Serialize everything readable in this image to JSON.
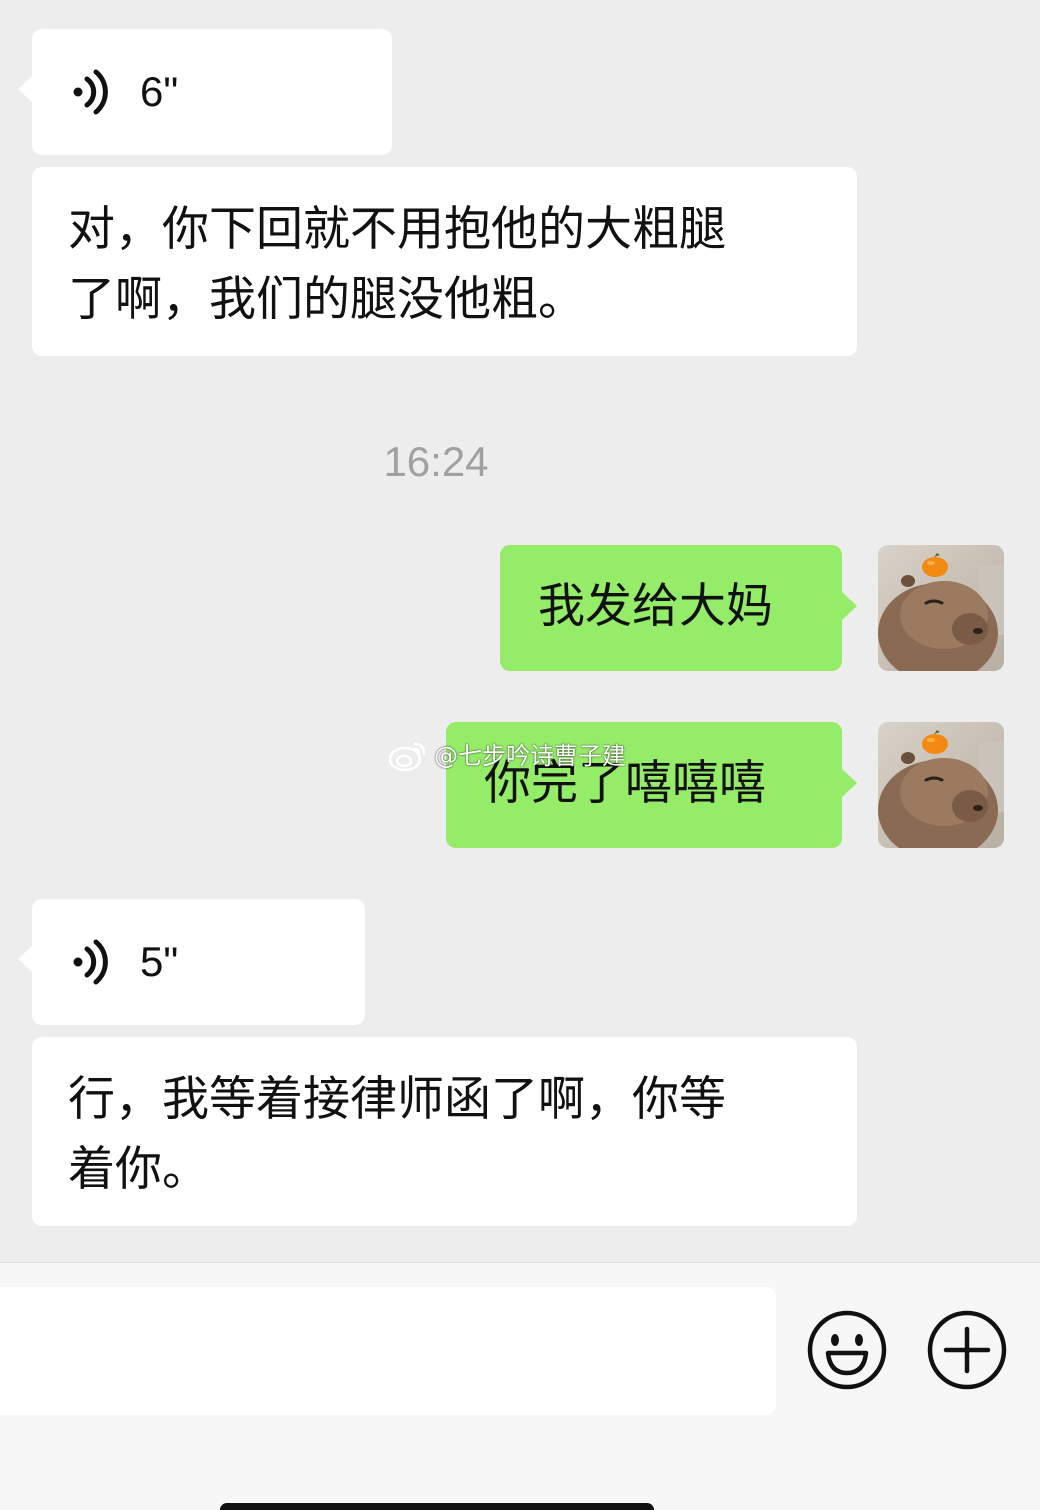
{
  "messages": [
    {
      "type": "voice",
      "direction": "incoming",
      "duration": "6\""
    },
    {
      "type": "text",
      "direction": "incoming",
      "lines": [
        "对，你下回就不用抱他的大粗腿",
        "了啊，我们的腿没他粗。"
      ]
    },
    {
      "type": "timestamp",
      "text": "16:24"
    },
    {
      "type": "text",
      "direction": "outgoing",
      "text": "我发给大妈",
      "avatar": "capybara-with-orange-avatar"
    },
    {
      "type": "text",
      "direction": "outgoing",
      "text": "你完了嘻嘻嘻",
      "avatar": "capybara-with-orange-avatar"
    },
    {
      "type": "voice",
      "direction": "incoming",
      "duration": "5\""
    },
    {
      "type": "text",
      "direction": "incoming",
      "lines": [
        "行，我等着接律师函了啊，你等",
        "着你。"
      ]
    }
  ],
  "watermark": {
    "text": "@七步吟诗曹子建",
    "icon": "weibo-icon"
  },
  "input_bar": {
    "text_value": "",
    "emoji_icon": "emoji-icon",
    "plus_icon": "plus-icon"
  },
  "colors": {
    "background": "#ededed",
    "incoming_bubble": "#ffffff",
    "outgoing_bubble": "#95ec69",
    "timestamp": "#a0a0a0"
  }
}
